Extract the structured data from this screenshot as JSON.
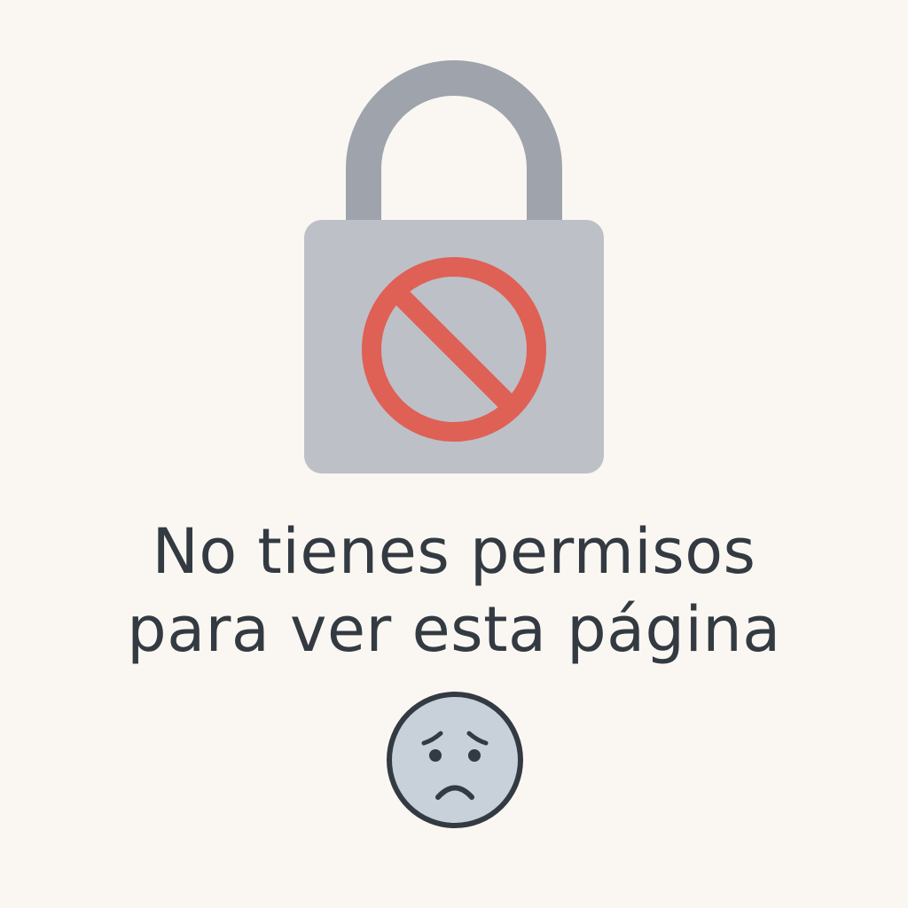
{
  "message": {
    "line1": "No tienes permisos",
    "line2": "para ver esta página"
  },
  "icons": {
    "lock": "padlock-icon",
    "blocked": "prohibited-icon",
    "face": "sad-face-icon"
  },
  "colors": {
    "background": "#faf7f2",
    "shackle": "#9ea3ac",
    "lock_body": "#bdc0c7",
    "prohibited": "#df6055",
    "text": "#333a41",
    "face_fill": "#c8d0da",
    "face_outline": "#333a41"
  }
}
